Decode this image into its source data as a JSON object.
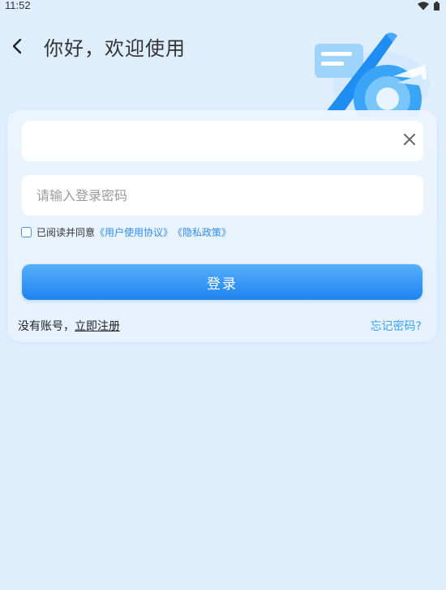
{
  "status_bar": {
    "time": "11:52",
    "wifi_icon": "wifi-icon",
    "battery_icon": "battery-icon"
  },
  "header": {
    "back_icon": "chevron-left-icon",
    "title": "你好，欢迎使用"
  },
  "form": {
    "account": {
      "value": "",
      "clear_icon": "close-icon"
    },
    "password": {
      "value": "",
      "placeholder": "请输入登录密码"
    },
    "agreement": {
      "checked": false,
      "prefix": "已阅读并同意",
      "user_agreement": "《用户使用协议》",
      "privacy_policy": "《隐私政策》"
    },
    "login_label": "登录"
  },
  "footer": {
    "no_account": "没有账号，",
    "register_label": "立即注册",
    "forgot_label": "忘记密码?"
  },
  "colors": {
    "background": "#dfeefd",
    "primary": "#1f83f0",
    "link": "#2f8cf0"
  }
}
